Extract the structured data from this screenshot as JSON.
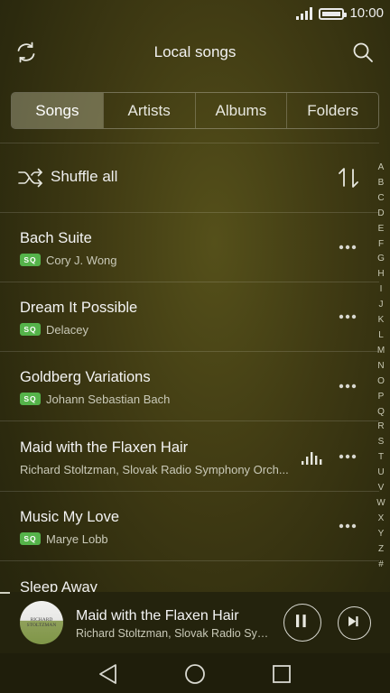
{
  "status_bar": {
    "time": "10:00"
  },
  "header": {
    "title": "Local songs"
  },
  "tabs": [
    {
      "label": "Songs",
      "active": true
    },
    {
      "label": "Artists",
      "active": false
    },
    {
      "label": "Albums",
      "active": false
    },
    {
      "label": "Folders",
      "active": false
    }
  ],
  "shuffle": {
    "label": "Shuffle all"
  },
  "songs": [
    {
      "title": "Bach Suite",
      "artist": "Cory J. Wong",
      "badge": "SQ"
    },
    {
      "title": "Dream It Possible",
      "artist": "Delacey",
      "badge": "SQ"
    },
    {
      "title": "Goldberg Variations",
      "artist": "Johann Sebastian Bach",
      "badge": "SQ"
    },
    {
      "title": "Maid with the Flaxen Hair",
      "artist": "Richard Stoltzman, Slovak Radio Symphony Orch...",
      "playing": true
    },
    {
      "title": "Music My Love",
      "artist": "Marye Lobb",
      "badge": "SQ"
    },
    {
      "title": "Sleep Away"
    }
  ],
  "index_letters": [
    "A",
    "B",
    "C",
    "D",
    "E",
    "F",
    "G",
    "H",
    "I",
    "J",
    "K",
    "L",
    "M",
    "N",
    "O",
    "P",
    "Q",
    "R",
    "S",
    "T",
    "U",
    "V",
    "W",
    "X",
    "Y",
    "Z",
    "#"
  ],
  "now_playing": {
    "title": "Maid with the Flaxen Hair",
    "artist": "Richard Stoltzman, Slovak Radio Symph...",
    "cover_text_1": "RICHARD",
    "cover_text_2": "STOLTZMAN"
  },
  "colors": {
    "background": "#3f3a13",
    "sq_badge": "#55b34a",
    "active_tab": "#8a8764"
  }
}
